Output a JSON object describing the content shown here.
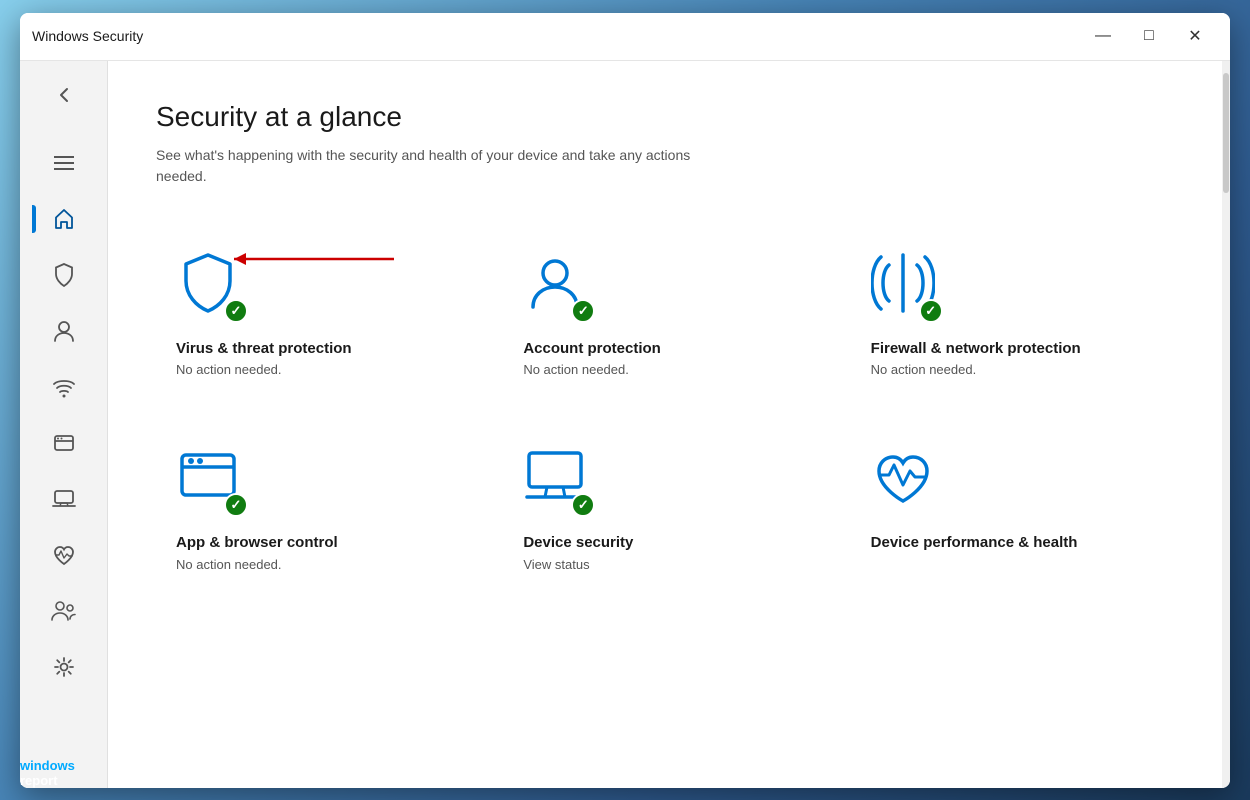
{
  "window": {
    "title": "Windows Security",
    "controls": {
      "minimize": "—",
      "maximize": "□",
      "close": "✕"
    }
  },
  "sidebar": {
    "items": [
      {
        "id": "back",
        "icon": "back",
        "label": "Back",
        "active": false
      },
      {
        "id": "menu",
        "icon": "menu",
        "label": "Menu",
        "active": false
      },
      {
        "id": "home",
        "icon": "home",
        "label": "Home",
        "active": true
      },
      {
        "id": "virus",
        "icon": "shield",
        "label": "Virus & threat protection",
        "active": false
      },
      {
        "id": "account",
        "icon": "person",
        "label": "Account protection",
        "active": false
      },
      {
        "id": "firewall",
        "icon": "wifi",
        "label": "Firewall & network protection",
        "active": false
      },
      {
        "id": "appbrowser",
        "icon": "browser",
        "label": "App & browser control",
        "active": false
      },
      {
        "id": "device",
        "icon": "device",
        "label": "Device security",
        "active": false
      },
      {
        "id": "health",
        "icon": "health",
        "label": "Device performance & health",
        "active": false
      },
      {
        "id": "family",
        "icon": "family",
        "label": "Family options",
        "active": false
      },
      {
        "id": "settings",
        "icon": "settings",
        "label": "Settings",
        "active": false
      }
    ]
  },
  "content": {
    "title": "Security at a glance",
    "subtitle": "See what's happening with the security and health of your device and take any actions needed.",
    "cards": [
      {
        "id": "virus",
        "title": "Virus & threat protection",
        "status": "No action needed.",
        "has_check": true,
        "annotated": true
      },
      {
        "id": "account",
        "title": "Account protection",
        "status": "No action needed.",
        "has_check": true,
        "annotated": false
      },
      {
        "id": "firewall",
        "title": "Firewall & network protection",
        "status": "No action needed.",
        "has_check": true,
        "annotated": false
      },
      {
        "id": "appbrowser",
        "title": "App & browser control",
        "status": "No action needed.",
        "has_check": true,
        "annotated": false
      },
      {
        "id": "devicesecurity",
        "title": "Device security",
        "status": "View status",
        "has_check": true,
        "annotated": false
      },
      {
        "id": "devicehealth",
        "title": "Device performance & health",
        "status": "",
        "has_check": false,
        "annotated": false
      }
    ]
  },
  "watermark": {
    "windows": "windows",
    "report": "report"
  },
  "colors": {
    "blue": "#0078d4",
    "green": "#107c10",
    "active_sidebar": "#005499",
    "arrow_red": "#cc0000"
  }
}
